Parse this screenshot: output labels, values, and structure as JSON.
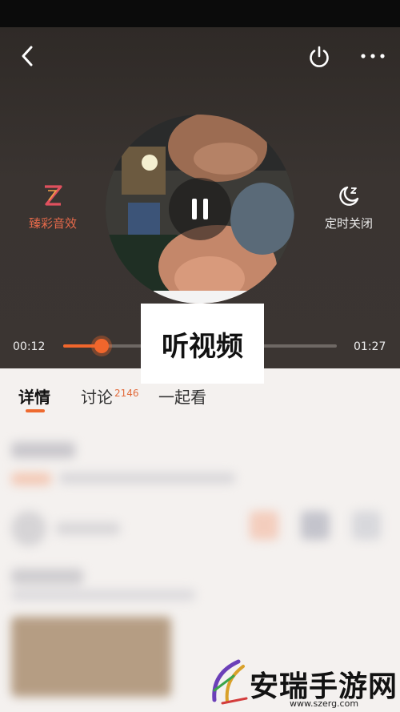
{
  "player": {
    "current_time": "00:12",
    "total_time": "01:27",
    "progress_fraction": 0.14,
    "state": "playing",
    "sound_effect_label": "臻彩音效",
    "sleep_timer_label": "定时关闭"
  },
  "overlay": {
    "caption": "听视频"
  },
  "tabs": [
    {
      "label": "详情",
      "active": true
    },
    {
      "label": "讨论",
      "badge": "2146"
    },
    {
      "label": "一起看"
    }
  ],
  "watermark": {
    "brand": "安瑞手游网",
    "url": "www.szerg.com"
  },
  "colors": {
    "accent": "#f0662c",
    "player_bg": "#3a3431",
    "status_bar": "#0b0b0b"
  },
  "icons": {
    "back": "chevron-left-icon",
    "power": "power-icon",
    "more": "more-dots-icon",
    "sound_effect": "z-logo-icon",
    "sleep_timer": "moon-zz-icon",
    "play_pause": "pause-icon"
  }
}
